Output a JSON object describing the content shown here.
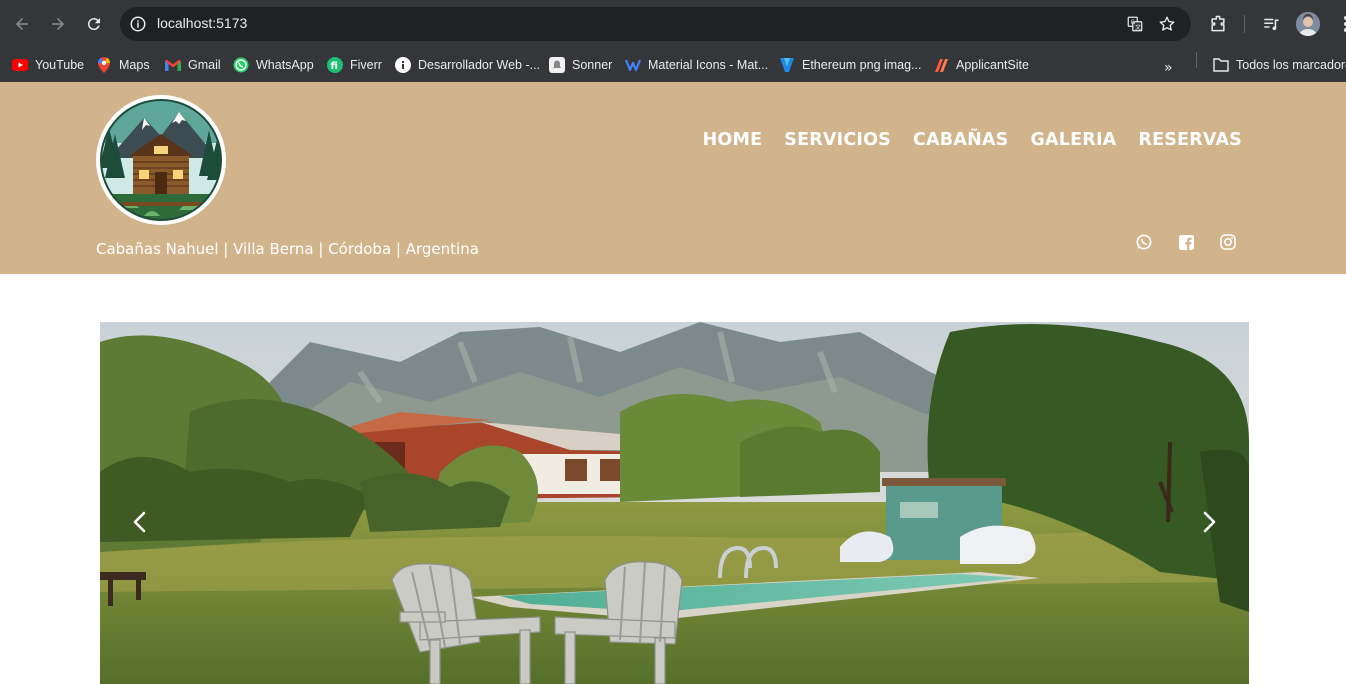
{
  "browser": {
    "url": "localhost:5173",
    "bookmarks": [
      {
        "label": "YouTube",
        "icon": "youtube-icon"
      },
      {
        "label": "Maps",
        "icon": "maps-icon"
      },
      {
        "label": "Gmail",
        "icon": "gmail-icon"
      },
      {
        "label": "WhatsApp",
        "icon": "whatsapp-icon"
      },
      {
        "label": "Fiverr",
        "icon": "fiverr-icon"
      },
      {
        "label": "Desarrollador Web -...",
        "icon": "info-icon"
      },
      {
        "label": "Sonner",
        "icon": "sonner-icon"
      },
      {
        "label": "Material Icons - Mat...",
        "icon": "material-icon"
      },
      {
        "label": "Ethereum png imag...",
        "icon": "ethereum-icon"
      },
      {
        "label": "ApplicantSite",
        "icon": "applicantsite-icon"
      }
    ],
    "all_bookmarks": "Todos los marcadores"
  },
  "site": {
    "tagline": "Cabañas Nahuel | Villa Berna | Córdoba | Argentina",
    "nav": [
      "HOME",
      "SERVICIOS",
      "CABAÑAS",
      "GALERIA",
      "RESERVAS"
    ],
    "social": [
      "whatsapp-icon",
      "facebook-icon",
      "instagram-icon"
    ],
    "header_color": "#d2b48c"
  },
  "carousel": {
    "prev_icon": "chevron-left-icon",
    "next_icon": "chevron-right-icon"
  }
}
